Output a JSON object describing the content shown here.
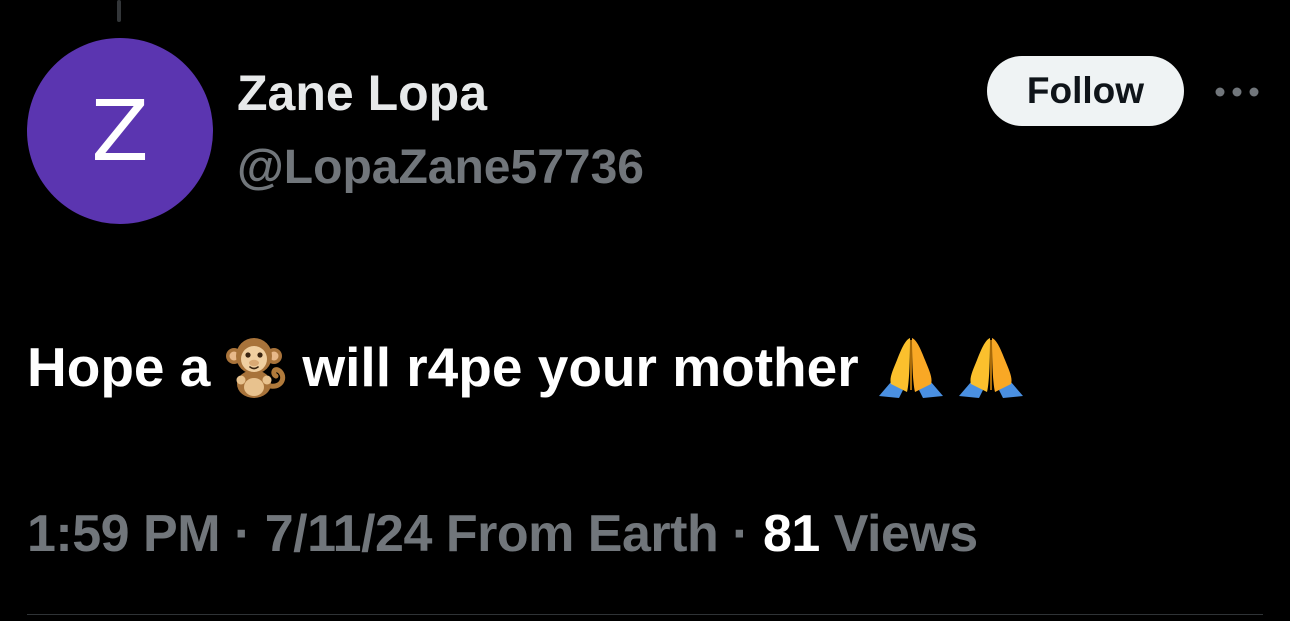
{
  "author": {
    "avatar_letter": "Z",
    "avatar_color": "#5b35b0",
    "display_name": "Zane Lopa",
    "handle": "@LopaZane57736"
  },
  "actions": {
    "follow_label": "Follow",
    "more_icon": "more-horizontal-icon"
  },
  "tweet": {
    "text_before_emoji": "Hope a",
    "emoji_1": "monkey-emoji",
    "text_after_emoji": "will r4pe your mother",
    "emoji_2": "folded-hands-emoji",
    "emoji_3": "folded-hands-emoji"
  },
  "meta": {
    "time": "1:59 PM",
    "separator": "·",
    "date": "7/11/24",
    "source": "From Earth",
    "views_count": "81",
    "views_label": "Views"
  },
  "colors": {
    "background": "#000000",
    "primary_text": "#e7e9ea",
    "secondary_text": "#71767b",
    "follow_bg": "#eff3f4",
    "divider": "#2f3336"
  }
}
